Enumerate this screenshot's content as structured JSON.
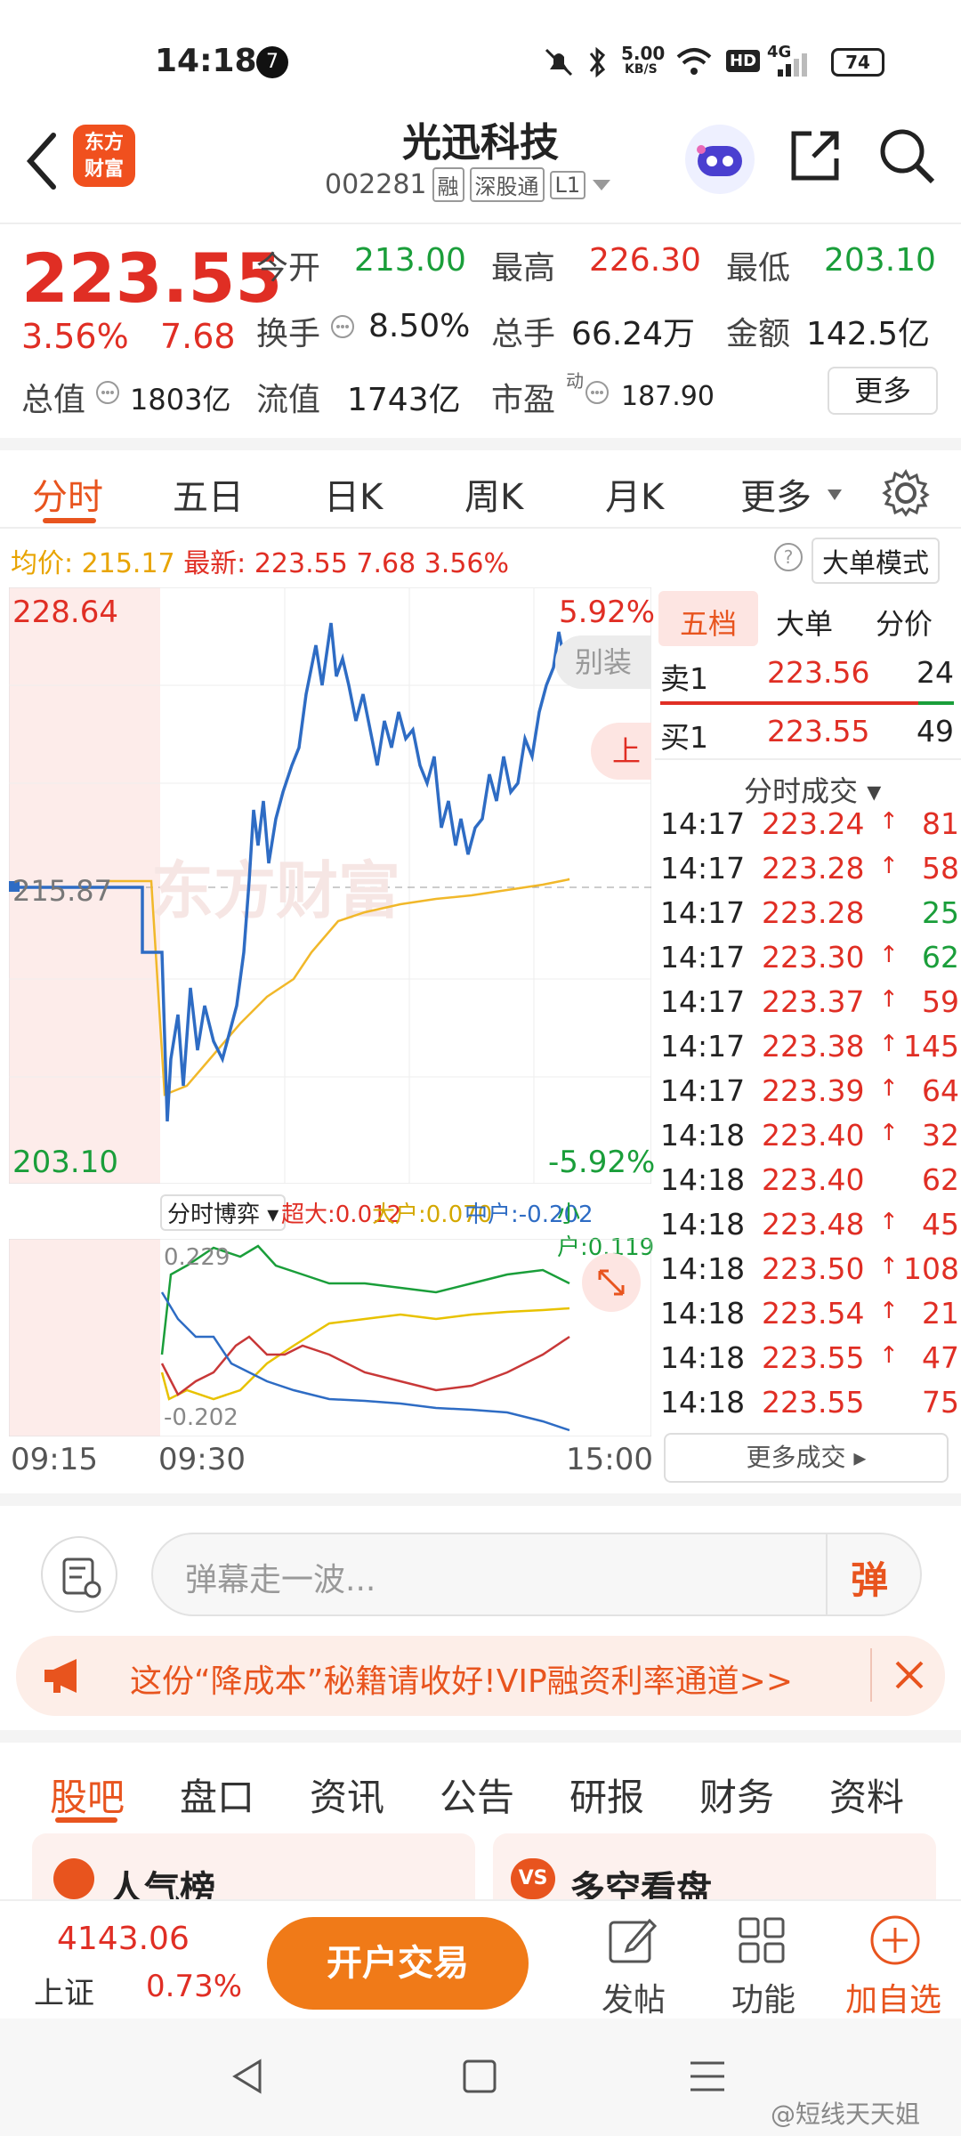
{
  "status_bar": {
    "time": "14:18",
    "notif_count": "7",
    "net_speed_top": "5.00",
    "net_speed_unit": "KB/S",
    "hd": "HD",
    "net_gen": "4G",
    "battery": "74"
  },
  "header": {
    "logo_line1": "东方",
    "logo_line2": "财富",
    "title": "光迅科技",
    "code": "002281",
    "tags": [
      "融",
      "深股通",
      "L1"
    ]
  },
  "quote": {
    "price": "223.55",
    "change_pct": "3.56%",
    "change": "7.68",
    "open_label": "今开",
    "open": "213.00",
    "high_label": "最高",
    "high": "226.30",
    "low_label": "最低",
    "low": "203.10",
    "turnover_label": "换手",
    "turnover": "8.50%",
    "volume_label": "总手",
    "volume": "66.24万",
    "amount_label": "金额",
    "amount": "142.5亿",
    "mktcap_label": "总值",
    "mktcap": "1803亿",
    "float_label": "流值",
    "float": "1743亿",
    "pe_label": "市盈",
    "pe_sup": "动",
    "pe": "187.90",
    "more": "更多"
  },
  "tabs": [
    "分时",
    "五日",
    "日K",
    "周K",
    "月K",
    "更多"
  ],
  "avg_line": {
    "avg_label": "均价:",
    "avg": "215.17",
    "latest_label": "最新:",
    "latest": "223.55",
    "chg": "7.68",
    "pct": "3.56%",
    "mode_btn": "大单模式"
  },
  "chart_labels": {
    "top_price": "228.64",
    "mid_price": "215.87",
    "bottom_price": "203.10",
    "top_pct": "5.92%",
    "bottom_pct": "-5.92%",
    "side_tip1": "别装",
    "side_tip2": "上",
    "watermark": "东方财富"
  },
  "flow": {
    "selector": "分时博弈",
    "super_label": "超大:",
    "super": "0.012",
    "big_label": "大户:",
    "big": "0.070",
    "mid_label": "中户:",
    "mid": "-0.202",
    "small_label": "小户:",
    "small": "0.119",
    "max": "0.229",
    "min": "-0.202"
  },
  "time_axis": [
    "09:15",
    "09:30",
    "15:00"
  ],
  "side_tabs": [
    "五档",
    "大单",
    "分价"
  ],
  "orderbook": [
    {
      "label": "卖1",
      "price": "223.56",
      "qty": "24"
    },
    {
      "label": "买1",
      "price": "223.55",
      "qty": "49"
    }
  ],
  "trades_header": "分时成交",
  "trades": [
    {
      "t": "14:17",
      "p": "223.24",
      "up": true,
      "v": "81",
      "vc": "red"
    },
    {
      "t": "14:17",
      "p": "223.28",
      "up": true,
      "v": "58",
      "vc": "red"
    },
    {
      "t": "14:17",
      "p": "223.28",
      "up": false,
      "v": "25",
      "vc": "green"
    },
    {
      "t": "14:17",
      "p": "223.30",
      "up": true,
      "v": "62",
      "vc": "green"
    },
    {
      "t": "14:17",
      "p": "223.37",
      "up": true,
      "v": "59",
      "vc": "red"
    },
    {
      "t": "14:17",
      "p": "223.38",
      "up": true,
      "v": "145",
      "vc": "red"
    },
    {
      "t": "14:17",
      "p": "223.39",
      "up": true,
      "v": "64",
      "vc": "red"
    },
    {
      "t": "14:18",
      "p": "223.40",
      "up": true,
      "v": "32",
      "vc": "red"
    },
    {
      "t": "14:18",
      "p": "223.40",
      "up": false,
      "v": "62",
      "vc": "red"
    },
    {
      "t": "14:18",
      "p": "223.48",
      "up": true,
      "v": "45",
      "vc": "red"
    },
    {
      "t": "14:18",
      "p": "223.50",
      "up": true,
      "v": "108",
      "vc": "red"
    },
    {
      "t": "14:18",
      "p": "223.54",
      "up": true,
      "v": "21",
      "vc": "red"
    },
    {
      "t": "14:18",
      "p": "223.55",
      "up": true,
      "v": "47",
      "vc": "red"
    },
    {
      "t": "14:18",
      "p": "223.55",
      "up": false,
      "v": "75",
      "vc": "red"
    }
  ],
  "more_trades": "更多成交",
  "danmu": {
    "placeholder": "弹幕走一波...",
    "btn": "弹"
  },
  "promo": "这份“降成本”秘籍请收好!VIP融资利率通道>>",
  "bottom_tabs": [
    "股吧",
    "盘口",
    "资讯",
    "公告",
    "研报",
    "财务",
    "资料"
  ],
  "cards": {
    "left": "人气榜",
    "right": "多空看盘",
    "right_badge": "VS"
  },
  "footer": {
    "index_value": "4143.06",
    "index_name": "上证",
    "index_pct": "0.73%",
    "trade_btn": "开户交易",
    "post": "发帖",
    "func": "功能",
    "add": "加自选"
  },
  "watermark_text": "@短线天天姐"
}
